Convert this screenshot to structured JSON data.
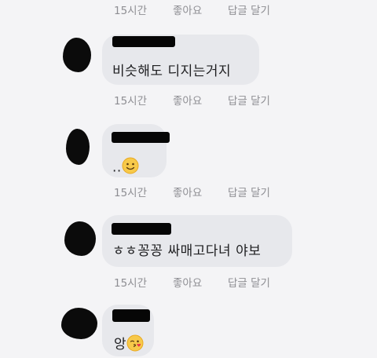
{
  "comments": [
    {
      "text": "",
      "actions": {
        "time": "15시간",
        "like": "좋아요",
        "reply": "답글 달기"
      }
    },
    {
      "text": "비슷해도 디지는거지",
      "actions": {
        "time": "15시간",
        "like": "좋아요",
        "reply": "답글 달기"
      }
    },
    {
      "text": "..",
      "emoji": "slightly-smiling-face-icon",
      "actions": {
        "time": "15시간",
        "like": "좋아요",
        "reply": "답글 달기"
      }
    },
    {
      "text": "ㅎㅎ꽁꽁 싸매고다녀 야보",
      "actions": {
        "time": "15시간",
        "like": "좋아요",
        "reply": "답글 달기"
      }
    },
    {
      "text": "앙",
      "emoji": "face-blowing-kiss-icon"
    }
  ]
}
